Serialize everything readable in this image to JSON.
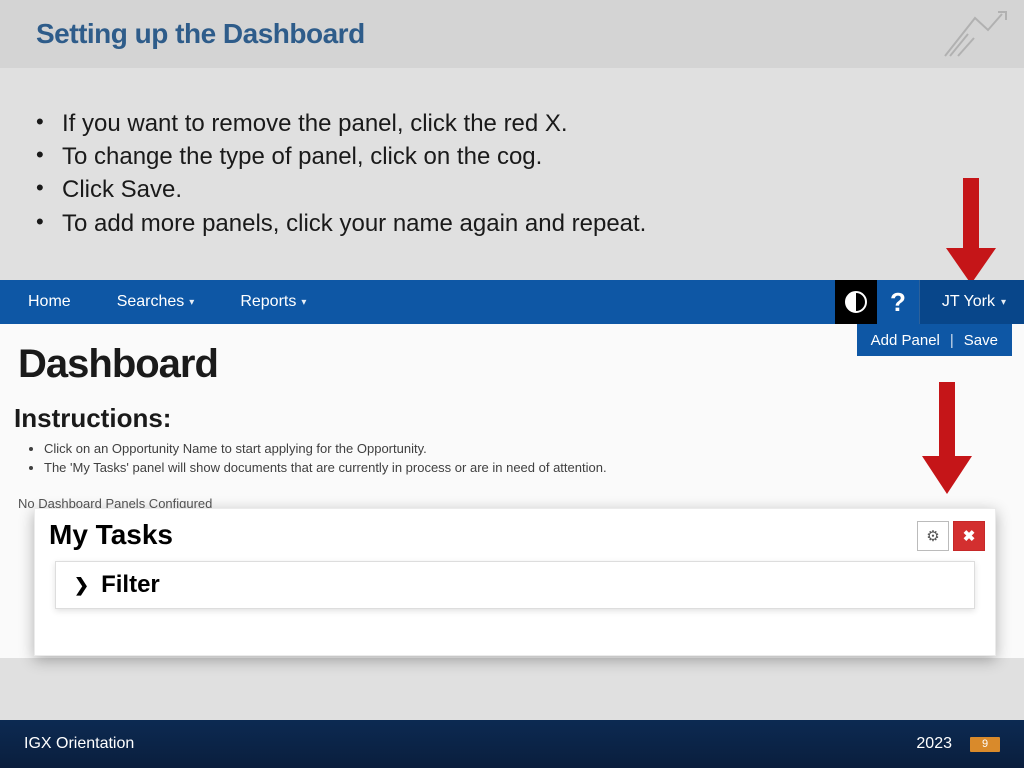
{
  "slide": {
    "title": "Setting up the Dashboard",
    "bullets": [
      "If you want to remove the panel, click the red X.",
      "To change the type of panel, click on the cog.",
      "Click Save.",
      "To add more panels, click your name again and repeat."
    ]
  },
  "nav": {
    "home": "Home",
    "searches": "Searches",
    "reports": "Reports",
    "user": "JT York"
  },
  "subbar": {
    "add_panel": "Add Panel",
    "save": "Save"
  },
  "dashboard": {
    "title": "Dashboard",
    "instructions_heading": "Instructions:",
    "instructions": [
      "Click on an Opportunity Name to start applying for the Opportunity.",
      "The 'My Tasks' panel will show documents that are currently in process or are in need of attention."
    ],
    "no_panels": "No Dashboard Panels Configured"
  },
  "panel": {
    "title": "My Tasks",
    "filter": "Filter"
  },
  "footer": {
    "left": "IGX Orientation",
    "year": "2023",
    "page": "9"
  }
}
